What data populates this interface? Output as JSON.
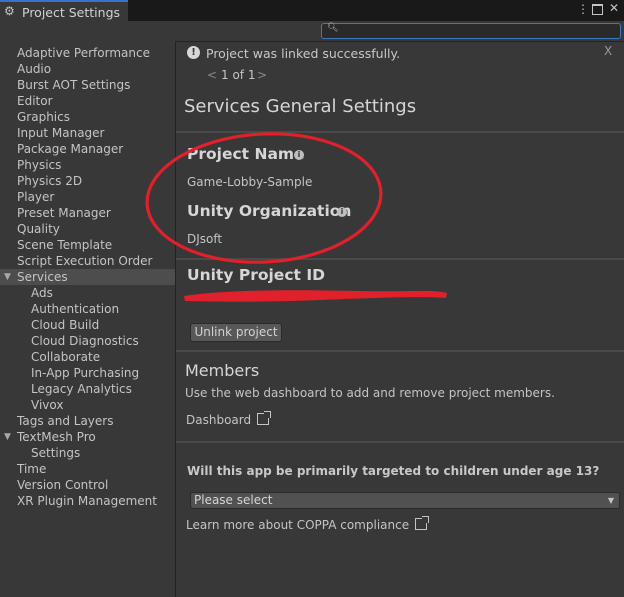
{
  "window": {
    "tab_title": "Project Settings",
    "menu_icon": "kebab-menu-icon",
    "maximize_icon": "maximize-icon",
    "close_label": "✕"
  },
  "search": {
    "placeholder": "",
    "value": ""
  },
  "sidebar": {
    "items": [
      {
        "label": "Adaptive Performance"
      },
      {
        "label": "Audio"
      },
      {
        "label": "Burst AOT Settings"
      },
      {
        "label": "Editor"
      },
      {
        "label": "Graphics"
      },
      {
        "label": "Input Manager"
      },
      {
        "label": "Package Manager"
      },
      {
        "label": "Physics"
      },
      {
        "label": "Physics 2D"
      },
      {
        "label": "Player"
      },
      {
        "label": "Preset Manager"
      },
      {
        "label": "Quality"
      },
      {
        "label": "Scene Template"
      },
      {
        "label": "Script Execution Order"
      },
      {
        "label": "Services"
      },
      {
        "label": "Ads"
      },
      {
        "label": "Authentication"
      },
      {
        "label": "Cloud Build"
      },
      {
        "label": "Cloud Diagnostics"
      },
      {
        "label": "Collaborate"
      },
      {
        "label": "In-App Purchasing"
      },
      {
        "label": "Legacy Analytics"
      },
      {
        "label": "Vivox"
      },
      {
        "label": "Tags and Layers"
      },
      {
        "label": "TextMesh Pro"
      },
      {
        "label": "Settings"
      },
      {
        "label": "Time"
      },
      {
        "label": "Version Control"
      },
      {
        "label": "XR Plugin Management"
      }
    ]
  },
  "notification": {
    "message": "Project was linked successfully.",
    "close": "X",
    "prev": "<",
    "pager": "1 of 1",
    "next": ">"
  },
  "main": {
    "title": "Services General Settings",
    "project_name_label": "Project Name",
    "project_name_value": "Game-Lobby-Sample",
    "org_label": "Unity Organization",
    "org_value": "DJsoft",
    "project_id_label": "Unity Project ID",
    "unlink_button": "Unlink project",
    "members_title": "Members",
    "members_desc": "Use the web dashboard to add and remove project members.",
    "dashboard_link": "Dashboard",
    "coppa_question": "Will this app be primarily targeted to children under age 13?",
    "coppa_select": "Please select",
    "coppa_link": "Learn more about COPPA compliance"
  },
  "colors": {
    "annotation_red": "#e0202a",
    "accent_blue": "#3a79c4",
    "panel_bg": "#383838"
  }
}
